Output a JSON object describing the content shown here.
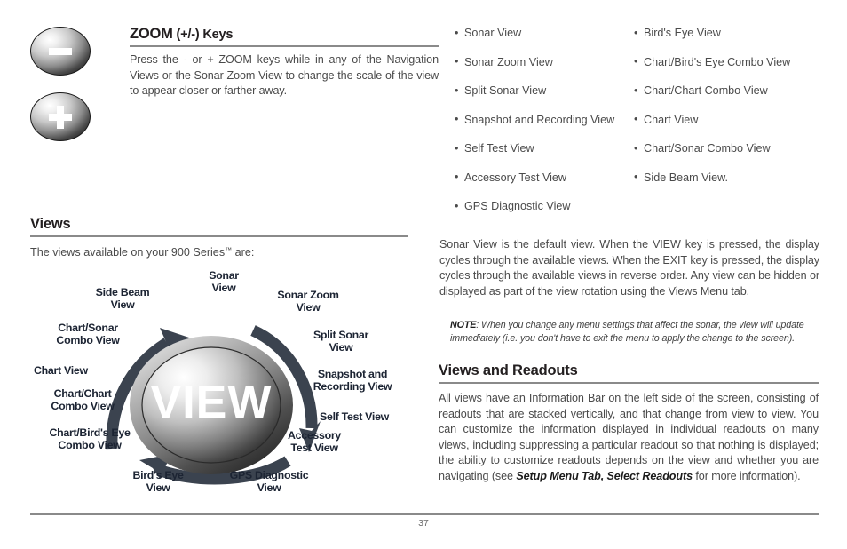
{
  "document": {
    "page_number": "37"
  },
  "zoom_keys": {
    "heading_main": "ZOOM",
    "heading_rest": " (+/-) Keys",
    "body": "Press the - or + ZOOM keys while in any of the Navigation Views or the Sonar Zoom View to change the scale of the view to appear closer or farther away.",
    "key_minus_name": "zoom-out",
    "key_plus_name": "zoom-in"
  },
  "views_section": {
    "heading": "Views",
    "intro_before": "The views available on your 900 Series",
    "intro_tm": "™",
    "intro_after": " are:"
  },
  "view_wheel": {
    "center_label": "VIEW",
    "labels": [
      "Sonar\nView",
      "Sonar Zoom\nView",
      "Split Sonar\nView",
      "Snapshot and\nRecording View",
      "Self Test View",
      "Accessory\nTest View",
      "GPS Diagnostic\nView",
      "Bird's Eye\nView",
      "Chart/Bird's Eye\nCombo View",
      "Chart/Chart\nCombo View",
      "Chart View",
      "Chart/Sonar\nCombo View",
      "Side Beam\nView"
    ]
  },
  "views_list": {
    "left_column": [
      "Sonar View",
      "Sonar Zoom View",
      "Split Sonar View",
      "Snapshot and Recording View",
      "Self Test View",
      "Accessory Test View",
      "GPS Diagnostic View"
    ],
    "right_column": [
      "Bird's Eye View",
      "Chart/Bird's Eye Combo View",
      "Chart/Chart Combo View",
      "Chart View",
      "Chart/Sonar Combo View",
      "Side Beam View."
    ]
  },
  "default_view_para": "Sonar View is the default view. When the VIEW key is pressed, the display cycles through the available views. When the EXIT key is pressed, the display cycles through the available views in reverse order. Any view can be hidden or displayed as part of the view rotation using the Views Menu tab.",
  "note": {
    "lead": "NOTE",
    "text": ": When you change any menu settings that affect the sonar, the view will update immediately (i.e. you don't have to exit the menu to apply the change to the screen)."
  },
  "views_readouts": {
    "heading": "Views and Readouts",
    "body_part1": "All views have an Information Bar on the left side of the screen, consisting of readouts that are stacked vertically, and that change from view to view. You can customize the information displayed in individual readouts on many views, including suppressing a particular readout so that nothing is displayed; the ability to customize readouts depends on the view and whether you are navigating (see ",
    "body_emphasis": "Setup Menu Tab, Select Readouts",
    "body_part2": " for more information)."
  },
  "colors": {
    "rule": "#8a8a8a",
    "heading": "#231f20",
    "body_text": "#4a4a4a",
    "wheel_label": "#1c2433",
    "arrow": "#3b434f"
  }
}
